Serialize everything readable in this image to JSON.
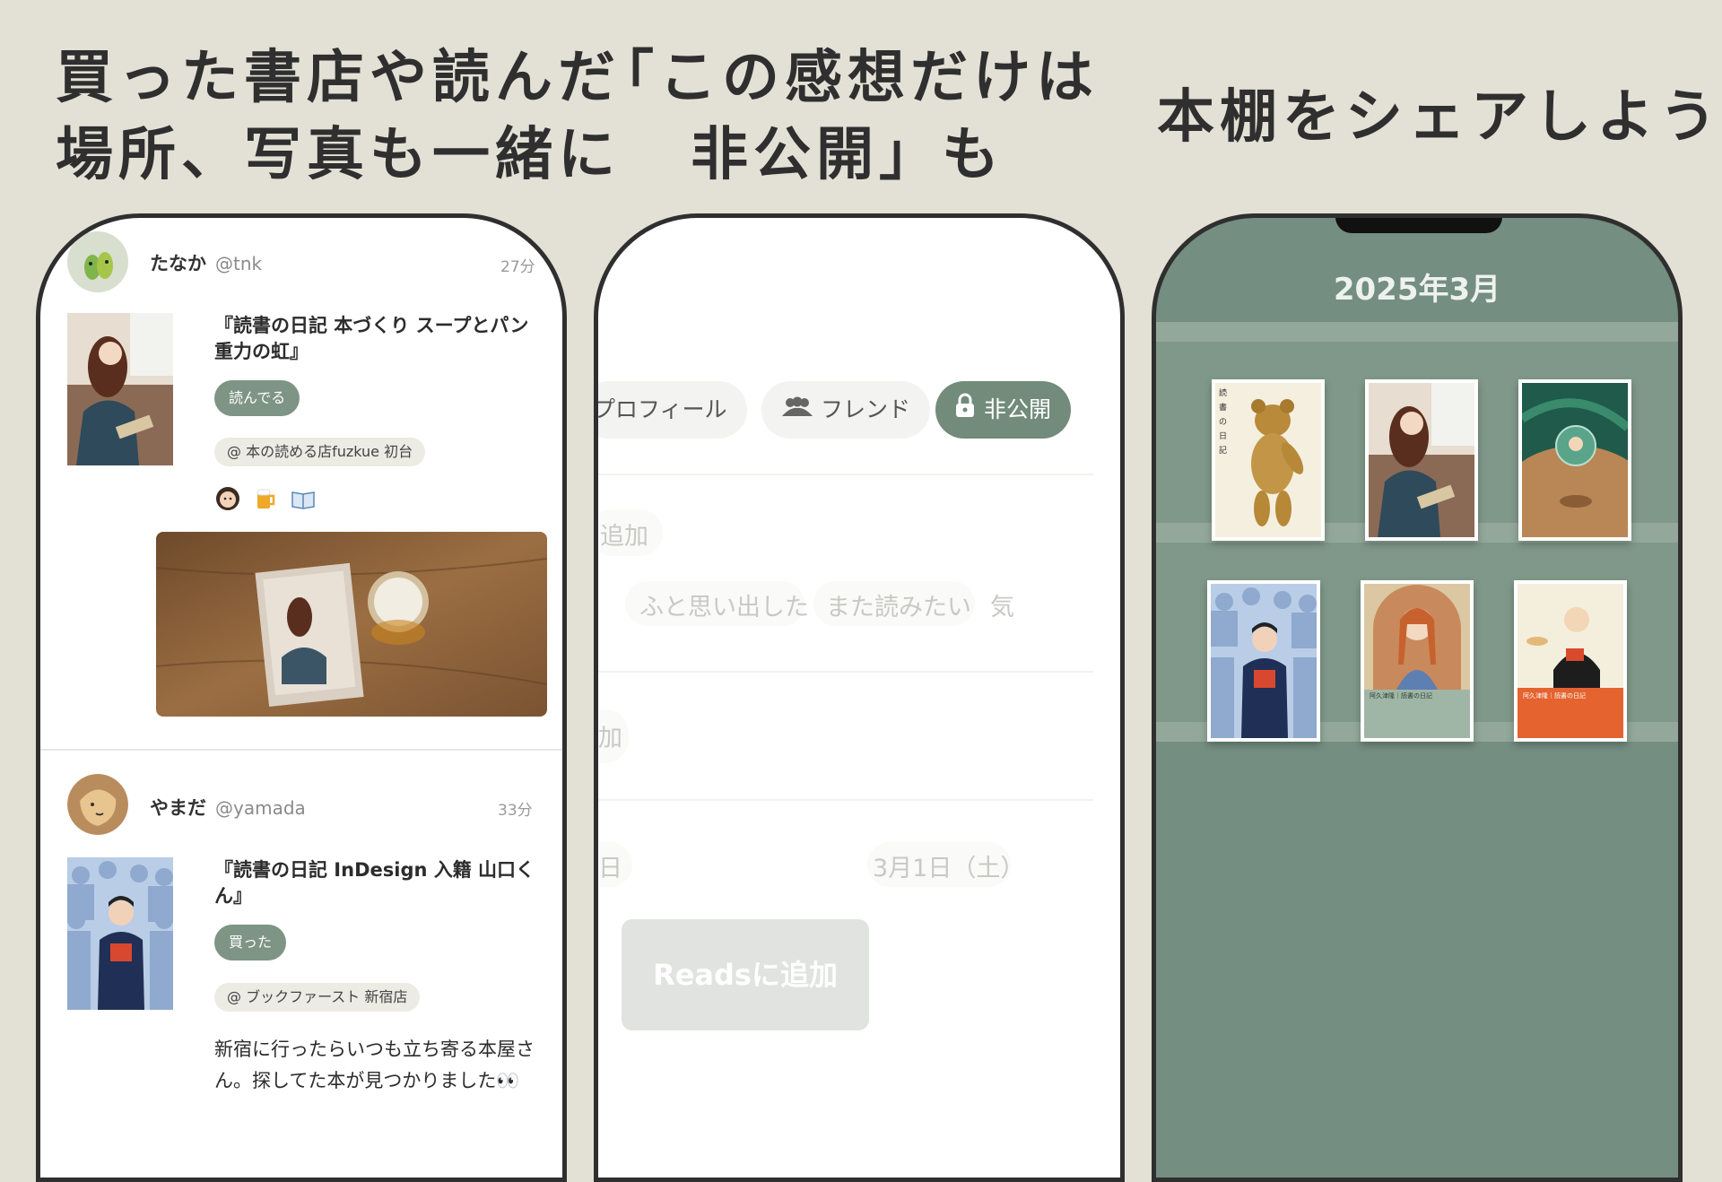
{
  "headlines": {
    "h1": [
      "買った書店や読んだ",
      "場所、写真も一緒に"
    ],
    "h2": [
      "「この感想だけは",
      "非公開」も"
    ],
    "h3": [
      "本棚をシェアしよう"
    ]
  },
  "feed": {
    "posts": [
      {
        "user": "たなか",
        "handle": "@tnk",
        "time": "27分",
        "title": "『読書の日記 本づくり スープとパン 重力の虹』",
        "status": "読んでる",
        "place": "@ 本の読める店fuzkue 初台",
        "reactions": [
          "woman-emoji",
          "beer-emoji",
          "book-emoji"
        ]
      },
      {
        "user": "やまだ",
        "handle": "@yamada",
        "time": "33分",
        "title": "『読書の日記 InDesign 入籍 山口くん』",
        "status": "買った",
        "place": "@ ブックファースト 新宿店",
        "comment": "新宿に行ったらいつも立ち寄る本屋さん。探してた本が見つかりました👀"
      }
    ]
  },
  "privacy": {
    "tabs": [
      {
        "label": "プロフィール",
        "icon": ""
      },
      {
        "label": "フレンド",
        "icon": "friends-icon"
      },
      {
        "label": "非公開",
        "icon": "lock-icon"
      }
    ],
    "add_label": "追加",
    "tags": [
      "ふと思い出した",
      "また読みたい",
      "気"
    ],
    "partial_char": "加",
    "date_left": "日",
    "date": "3月1日（土）",
    "reads_button": "Readsに追加"
  },
  "shelf": {
    "month": "2025年3月",
    "books": [
      {
        "name": "teddy-bear-cover",
        "title_mark": "読 書 の 日 記"
      },
      {
        "name": "woman-reading-cover"
      },
      {
        "name": "space-cover"
      },
      {
        "name": "crowd-cover"
      },
      {
        "name": "braids-cover",
        "caption": "阿久津隆｜読書の日記"
      },
      {
        "name": "orange-cover",
        "caption": "阿久津隆｜読書の日記"
      }
    ]
  },
  "colors": {
    "background": "#e3e1d6",
    "accent": "#728b7b",
    "shelf": "#748e81"
  }
}
